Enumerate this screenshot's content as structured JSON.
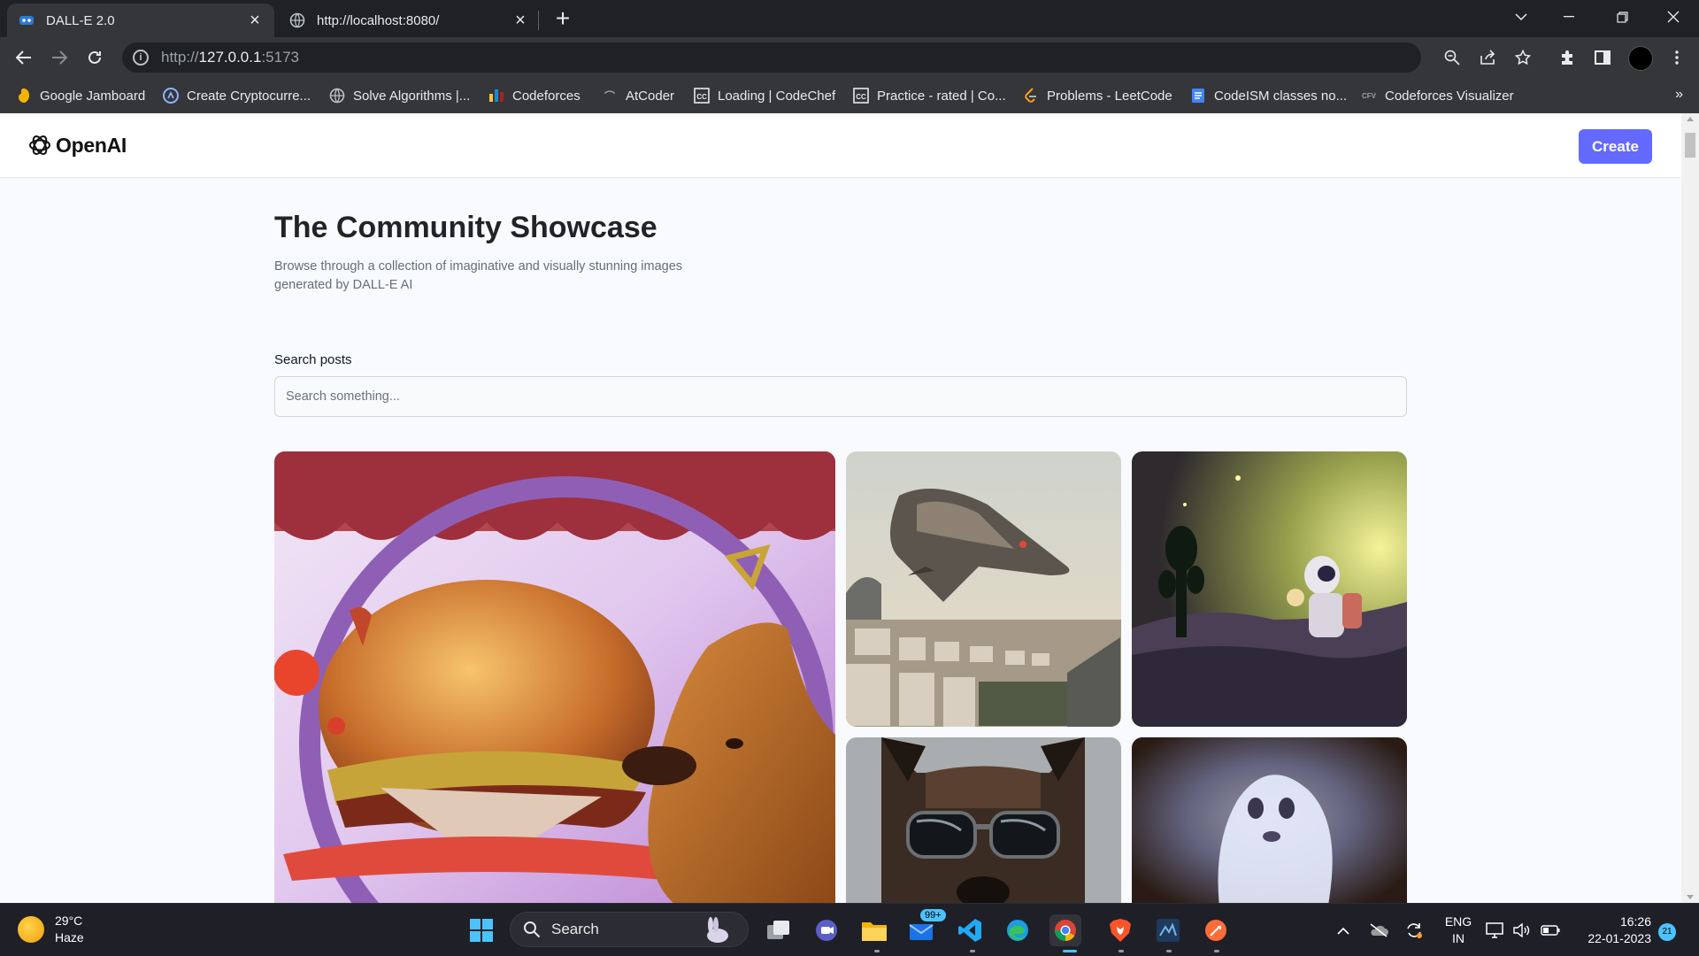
{
  "browser": {
    "tabs": [
      {
        "title": "DALL-E 2.0",
        "active": true
      },
      {
        "title": "http://localhost:8080/",
        "active": false
      }
    ],
    "url": {
      "scheme": "http://",
      "host": "127.0.0.1",
      "port": ":5173"
    },
    "bookmarks": [
      {
        "label": "Google Jamboard",
        "icon": "jamboard-icon"
      },
      {
        "label": "Create Cryptocurre...",
        "icon": "crypto-icon"
      },
      {
        "label": "Solve Algorithms |...",
        "icon": "globe-icon"
      },
      {
        "label": "Codeforces",
        "icon": "codeforces-icon"
      },
      {
        "label": "AtCoder",
        "icon": "atcoder-icon"
      },
      {
        "label": "Loading | CodeChef",
        "icon": "codechef-icon"
      },
      {
        "label": "Practice - rated | Co...",
        "icon": "codechef-icon"
      },
      {
        "label": "Problems - LeetCode",
        "icon": "leetcode-icon"
      },
      {
        "label": "CodeISM classes no...",
        "icon": "docs-icon"
      },
      {
        "label": "Codeforces Visualizer",
        "icon": "cfv-icon"
      }
    ],
    "bookmarks_more": "»"
  },
  "site": {
    "logo_text": "OpenAI",
    "create_label": "Create",
    "title": "The Community Showcase",
    "subtitle": "Browse through a collection of imaginative and visually stunning images generated by DALL-E AI",
    "search_label": "Search posts",
    "search_placeholder": "Search something...",
    "accent_color": "#6469ff"
  },
  "taskbar": {
    "weather": {
      "temp": "29°C",
      "condition": "Haze"
    },
    "search_label": "Search",
    "mail_badge": "99+",
    "language": {
      "line1": "ENG",
      "line2": "IN"
    },
    "clock": {
      "time": "16:26",
      "date": "22-01-2023"
    },
    "notifications": "21"
  }
}
